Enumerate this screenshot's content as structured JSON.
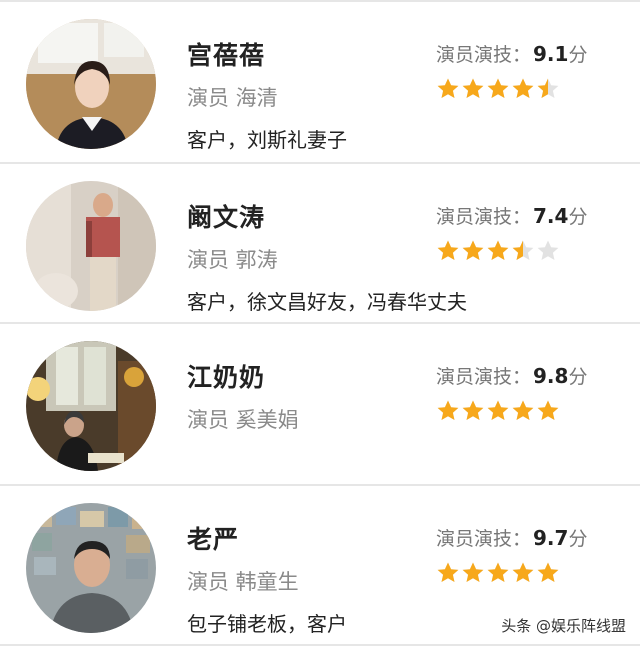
{
  "rating_label": "演员演技：",
  "score_unit": "分",
  "star_color": "#f7a81b",
  "star_empty_color": "#e2e2e2",
  "characters": [
    {
      "name": "宫蓓蓓",
      "role": "演员 海清",
      "description": "客户，刘斯礼妻子",
      "score": "9.1",
      "stars": 4.5
    },
    {
      "name": "阚文涛",
      "role": "演员 郭涛",
      "description": "客户，徐文昌好友，冯春华丈夫",
      "score": "7.4",
      "stars": 3.5
    },
    {
      "name": "江奶奶",
      "role": "演员 奚美娟",
      "description": "",
      "score": "9.8",
      "stars": 5
    },
    {
      "name": "老严",
      "role": "演员 韩童生",
      "description": "包子铺老板，客户",
      "score": "9.7",
      "stars": 5
    }
  ],
  "watermark": "头条 @娱乐阵线盟"
}
